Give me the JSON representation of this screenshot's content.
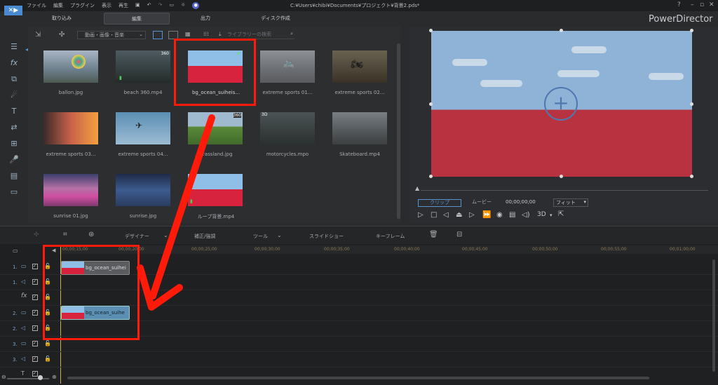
{
  "app": {
    "menu": [
      "ファイル",
      "編集",
      "プラグイン",
      "表示",
      "再生"
    ],
    "title": "C:¥Users¥chibi¥Documents¥プロジェクト¥背景2.pds*",
    "brand": "PowerDirector",
    "help": "?"
  },
  "tabs": [
    "取り込み",
    "編集",
    "出力",
    "ディスク作成"
  ],
  "library": {
    "filter": "動画・画像・音楽",
    "search_placeholder": "ライブラリーの検索",
    "items": [
      {
        "label": "ballon.jpg",
        "badge": ""
      },
      {
        "label": "beach 360.mp4",
        "badge": "360"
      },
      {
        "label": "bg_ocean_suiheis...",
        "badge": ""
      },
      {
        "label": "extreme sports 01...",
        "badge": ""
      },
      {
        "label": "extreme sports 02...",
        "badge": ""
      },
      {
        "label": "extreme sports 03...",
        "badge": ""
      },
      {
        "label": "extreme sports 04...",
        "badge": ""
      },
      {
        "label": "grassland.jpg",
        "badge": "360"
      },
      {
        "label": "motorcycles.mpo",
        "badge": "3D"
      },
      {
        "label": "Skateboard.mp4",
        "badge": ""
      },
      {
        "label": "sunrise 01.jpg",
        "badge": ""
      },
      {
        "label": "sunrise.jpg",
        "badge": ""
      },
      {
        "label": "ループ背景.mp4",
        "badge": ""
      }
    ]
  },
  "preview": {
    "clip_tab": "クリップ",
    "movie_tab": "ムービー",
    "timecode": "00;00;00;00",
    "fit": "フィット",
    "mode_3d": "3D"
  },
  "timeline": {
    "toolbar": [
      "デザイナー",
      "補正/強調",
      "ツール",
      "スライドショー",
      "キーフレーム"
    ],
    "ruler": [
      "00;00;15;00",
      "00;00;20;00",
      "00;00;25;00",
      "00;00;30;00",
      "00;00;35;00",
      "00;00;40;00",
      "00;00;45;00",
      "00;00;50;00",
      "00;00;55;00",
      "00;01;00;00"
    ],
    "tracks": [
      "1.",
      "1.",
      "",
      "2.",
      "2.",
      "3.",
      "3."
    ],
    "clips": [
      "bg_ocean_suihei",
      "bg_ocean_suihe"
    ]
  },
  "colors": {
    "annotation": "#ff1a0a",
    "sky": "#8fb3d6",
    "sea": "#b8323f"
  }
}
